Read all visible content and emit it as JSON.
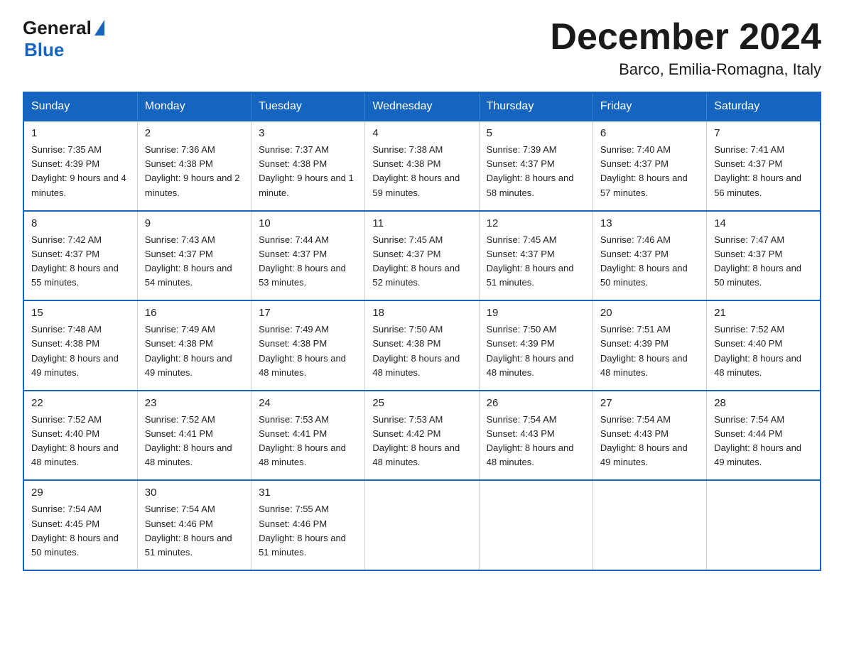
{
  "header": {
    "logo_general": "General",
    "logo_blue": "Blue",
    "title": "December 2024",
    "subtitle": "Barco, Emilia-Romagna, Italy"
  },
  "days_of_week": [
    "Sunday",
    "Monday",
    "Tuesday",
    "Wednesday",
    "Thursday",
    "Friday",
    "Saturday"
  ],
  "weeks": [
    [
      {
        "day": "1",
        "sunrise": "7:35 AM",
        "sunset": "4:39 PM",
        "daylight": "9 hours and 4 minutes."
      },
      {
        "day": "2",
        "sunrise": "7:36 AM",
        "sunset": "4:38 PM",
        "daylight": "9 hours and 2 minutes."
      },
      {
        "day": "3",
        "sunrise": "7:37 AM",
        "sunset": "4:38 PM",
        "daylight": "9 hours and 1 minute."
      },
      {
        "day": "4",
        "sunrise": "7:38 AM",
        "sunset": "4:38 PM",
        "daylight": "8 hours and 59 minutes."
      },
      {
        "day": "5",
        "sunrise": "7:39 AM",
        "sunset": "4:37 PM",
        "daylight": "8 hours and 58 minutes."
      },
      {
        "day": "6",
        "sunrise": "7:40 AM",
        "sunset": "4:37 PM",
        "daylight": "8 hours and 57 minutes."
      },
      {
        "day": "7",
        "sunrise": "7:41 AM",
        "sunset": "4:37 PM",
        "daylight": "8 hours and 56 minutes."
      }
    ],
    [
      {
        "day": "8",
        "sunrise": "7:42 AM",
        "sunset": "4:37 PM",
        "daylight": "8 hours and 55 minutes."
      },
      {
        "day": "9",
        "sunrise": "7:43 AM",
        "sunset": "4:37 PM",
        "daylight": "8 hours and 54 minutes."
      },
      {
        "day": "10",
        "sunrise": "7:44 AM",
        "sunset": "4:37 PM",
        "daylight": "8 hours and 53 minutes."
      },
      {
        "day": "11",
        "sunrise": "7:45 AM",
        "sunset": "4:37 PM",
        "daylight": "8 hours and 52 minutes."
      },
      {
        "day": "12",
        "sunrise": "7:45 AM",
        "sunset": "4:37 PM",
        "daylight": "8 hours and 51 minutes."
      },
      {
        "day": "13",
        "sunrise": "7:46 AM",
        "sunset": "4:37 PM",
        "daylight": "8 hours and 50 minutes."
      },
      {
        "day": "14",
        "sunrise": "7:47 AM",
        "sunset": "4:37 PM",
        "daylight": "8 hours and 50 minutes."
      }
    ],
    [
      {
        "day": "15",
        "sunrise": "7:48 AM",
        "sunset": "4:38 PM",
        "daylight": "8 hours and 49 minutes."
      },
      {
        "day": "16",
        "sunrise": "7:49 AM",
        "sunset": "4:38 PM",
        "daylight": "8 hours and 49 minutes."
      },
      {
        "day": "17",
        "sunrise": "7:49 AM",
        "sunset": "4:38 PM",
        "daylight": "8 hours and 48 minutes."
      },
      {
        "day": "18",
        "sunrise": "7:50 AM",
        "sunset": "4:38 PM",
        "daylight": "8 hours and 48 minutes."
      },
      {
        "day": "19",
        "sunrise": "7:50 AM",
        "sunset": "4:39 PM",
        "daylight": "8 hours and 48 minutes."
      },
      {
        "day": "20",
        "sunrise": "7:51 AM",
        "sunset": "4:39 PM",
        "daylight": "8 hours and 48 minutes."
      },
      {
        "day": "21",
        "sunrise": "7:52 AM",
        "sunset": "4:40 PM",
        "daylight": "8 hours and 48 minutes."
      }
    ],
    [
      {
        "day": "22",
        "sunrise": "7:52 AM",
        "sunset": "4:40 PM",
        "daylight": "8 hours and 48 minutes."
      },
      {
        "day": "23",
        "sunrise": "7:52 AM",
        "sunset": "4:41 PM",
        "daylight": "8 hours and 48 minutes."
      },
      {
        "day": "24",
        "sunrise": "7:53 AM",
        "sunset": "4:41 PM",
        "daylight": "8 hours and 48 minutes."
      },
      {
        "day": "25",
        "sunrise": "7:53 AM",
        "sunset": "4:42 PM",
        "daylight": "8 hours and 48 minutes."
      },
      {
        "day": "26",
        "sunrise": "7:54 AM",
        "sunset": "4:43 PM",
        "daylight": "8 hours and 48 minutes."
      },
      {
        "day": "27",
        "sunrise": "7:54 AM",
        "sunset": "4:43 PM",
        "daylight": "8 hours and 49 minutes."
      },
      {
        "day": "28",
        "sunrise": "7:54 AM",
        "sunset": "4:44 PM",
        "daylight": "8 hours and 49 minutes."
      }
    ],
    [
      {
        "day": "29",
        "sunrise": "7:54 AM",
        "sunset": "4:45 PM",
        "daylight": "8 hours and 50 minutes."
      },
      {
        "day": "30",
        "sunrise": "7:54 AM",
        "sunset": "4:46 PM",
        "daylight": "8 hours and 51 minutes."
      },
      {
        "day": "31",
        "sunrise": "7:55 AM",
        "sunset": "4:46 PM",
        "daylight": "8 hours and 51 minutes."
      },
      null,
      null,
      null,
      null
    ]
  ]
}
